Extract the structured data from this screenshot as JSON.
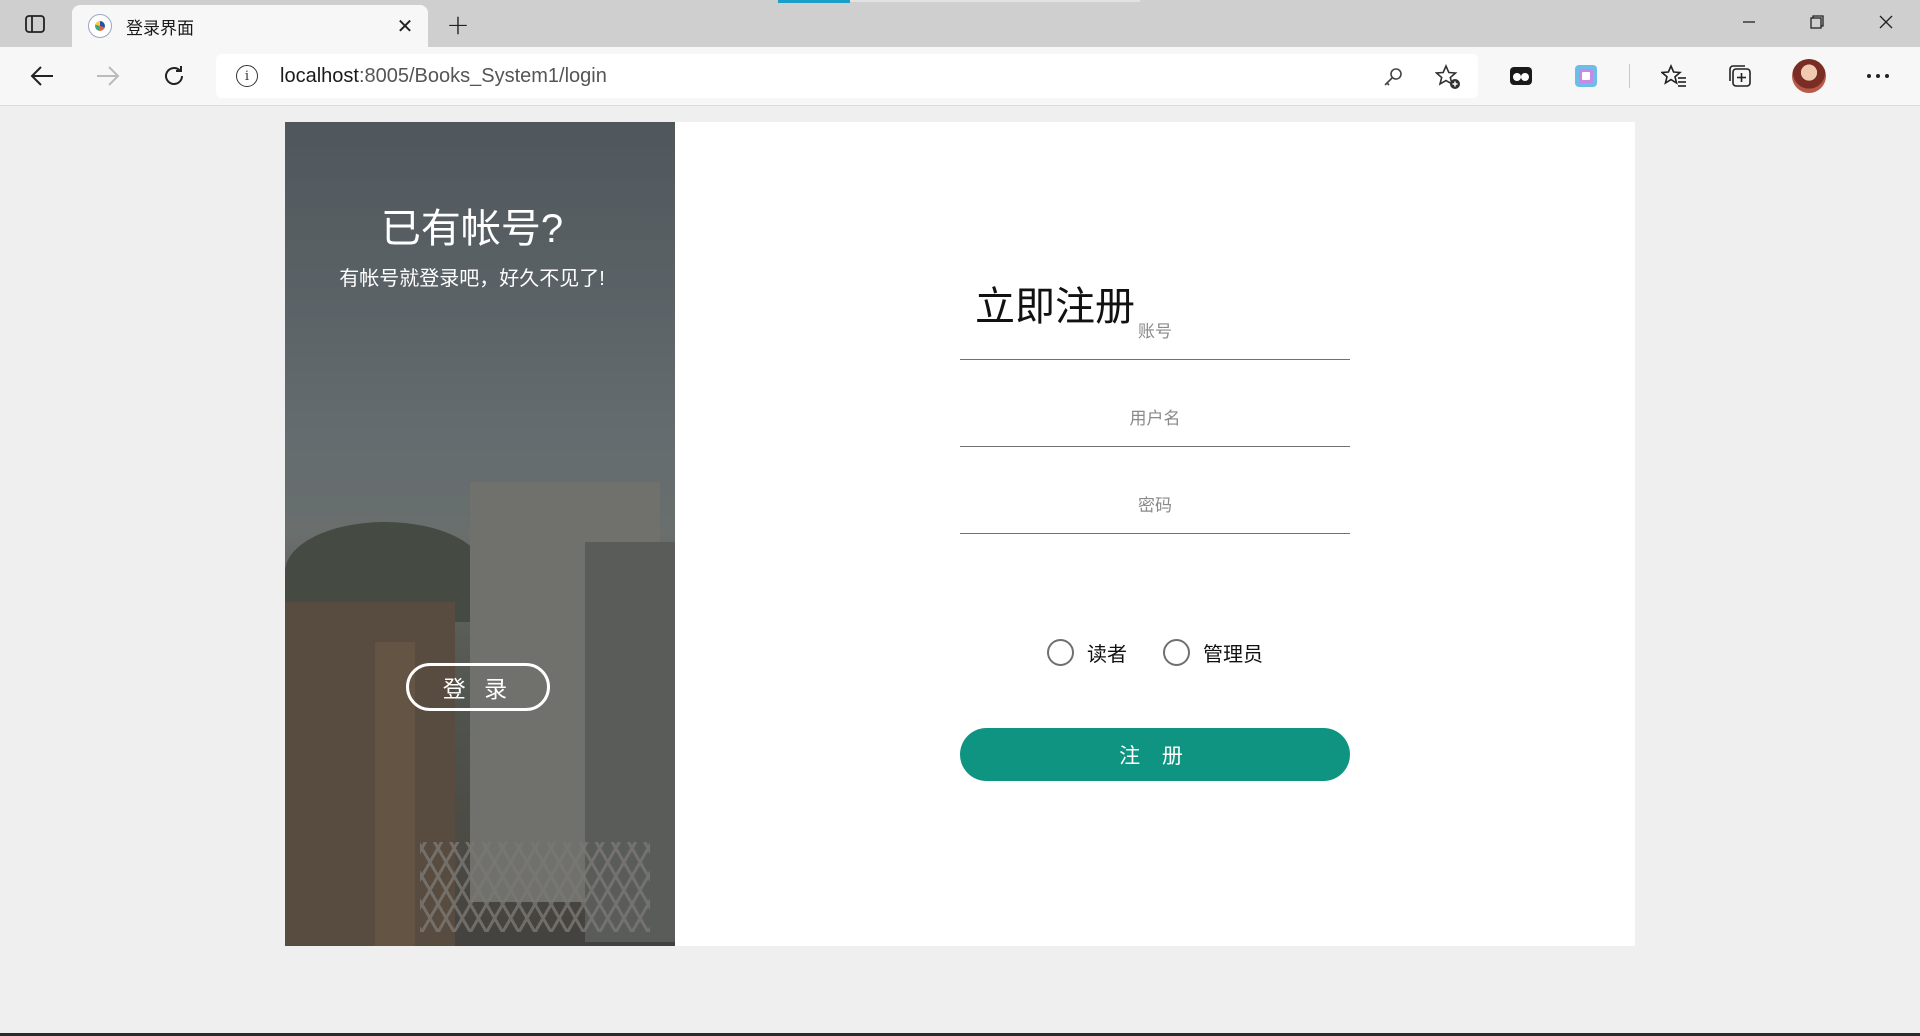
{
  "browser": {
    "tab_title": "登录界面",
    "tab_close": "✕",
    "new_tab": "+",
    "url_host": "localhost",
    "url_rest": ":8005/Books_System1/login"
  },
  "login_panel": {
    "title": "已有帐号?",
    "subtitle": "有帐号就登录吧，好久不见了!",
    "login_button": "登 录"
  },
  "register_form": {
    "title": "立即注册",
    "account_placeholder": "账号",
    "username_placeholder": "用户名",
    "password_placeholder": "密码",
    "role_options": [
      "读者",
      "管理员"
    ],
    "register_button": "注 册"
  },
  "colors": {
    "accent": "#0f9482",
    "page_bg": "#efefef"
  }
}
